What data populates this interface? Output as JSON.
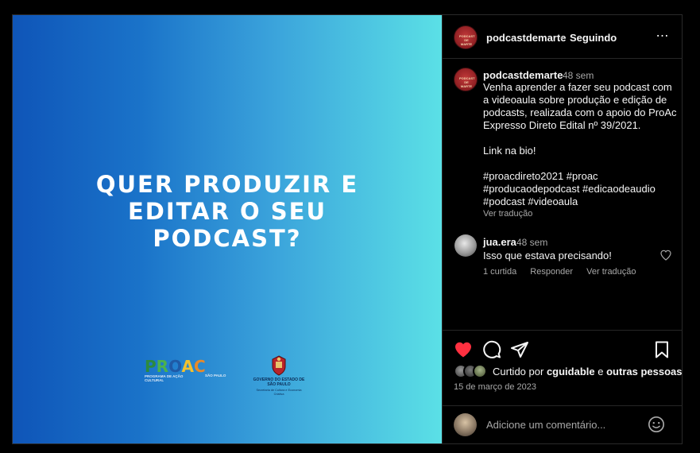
{
  "post": {
    "headline_lines": [
      "QUER PRODUZIR E",
      "EDITAR O SEU",
      "PODCAST?"
    ],
    "logos": {
      "proac": {
        "word": "PROAC",
        "subtitle": "PROGRAMA DE AÇÃO CULTURAL",
        "region": "SÃO PAULO"
      },
      "government": {
        "title": "GOVERNO DO ESTADO DE SÃO PAULO",
        "subtitle": "Secretaria de Cultura e Economia Criativa"
      }
    },
    "gradient": {
      "start": "#0f55b8",
      "end": "#5be0e6"
    }
  },
  "header": {
    "username": "podcastdemarte",
    "separator": "•",
    "follow_status": "Seguindo",
    "more_icon": "⋯",
    "avatar_text": "PODCAST DE MARTE"
  },
  "caption": {
    "username": "podcastdemarte",
    "time": "48 sem",
    "text": "Venha aprender a fazer seu podcast com a videoaula sobre produção e edição de podcasts, realizada com o apoio do ProAc Expresso Direto Edital nº 39/2021.\n\nLink na bio!\n\n#proacdireto2021 #proac #producaodepodcast #edicaodeaudio #podcast #videoaula",
    "translate": "Ver tradução"
  },
  "comment": {
    "username": "jua.era",
    "time": "48 sem",
    "text": "Isso que estava precisando!",
    "likes": "1 curtida",
    "reply": "Responder",
    "translate": "Ver tradução"
  },
  "engagement": {
    "liked_prefix": "Curtido por",
    "liked_user": "cguidable",
    "liked_connector": "e",
    "liked_others": "outras pessoas",
    "date": "15 de março de 2023",
    "like_color": "#ff3040"
  },
  "add_comment": {
    "placeholder": "Adicione um comentário..."
  }
}
